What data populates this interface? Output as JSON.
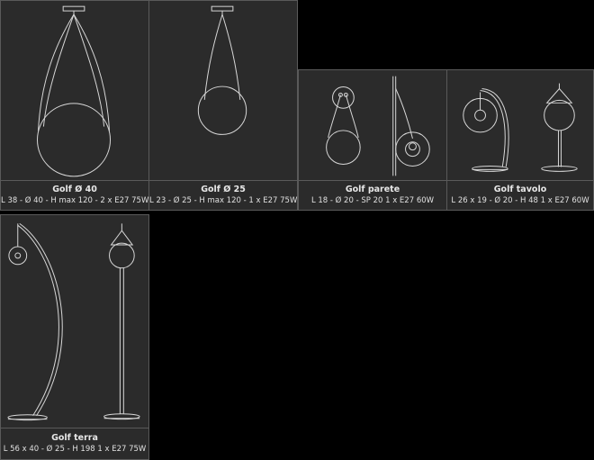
{
  "products": [
    {
      "name": "Golf Ø 40",
      "spec": "L 38 - Ø 40 - H max 120 - 2 x E27 75W"
    },
    {
      "name": "Golf Ø 25",
      "spec": "L 23 - Ø 25 - H max 120 - 1 x E27 75W"
    },
    {
      "name": "Golf parete",
      "spec": "L 18 - Ø 20 - SP 20 1 x E27 60W"
    },
    {
      "name": "Golf tavolo",
      "spec": "L 26 x 19 - Ø 20 - H 48 1 x E27 60W"
    },
    {
      "name": "Golf terra",
      "spec": "L 56 x 40 - Ø 25 - H 198 1 x E27 75W"
    }
  ]
}
